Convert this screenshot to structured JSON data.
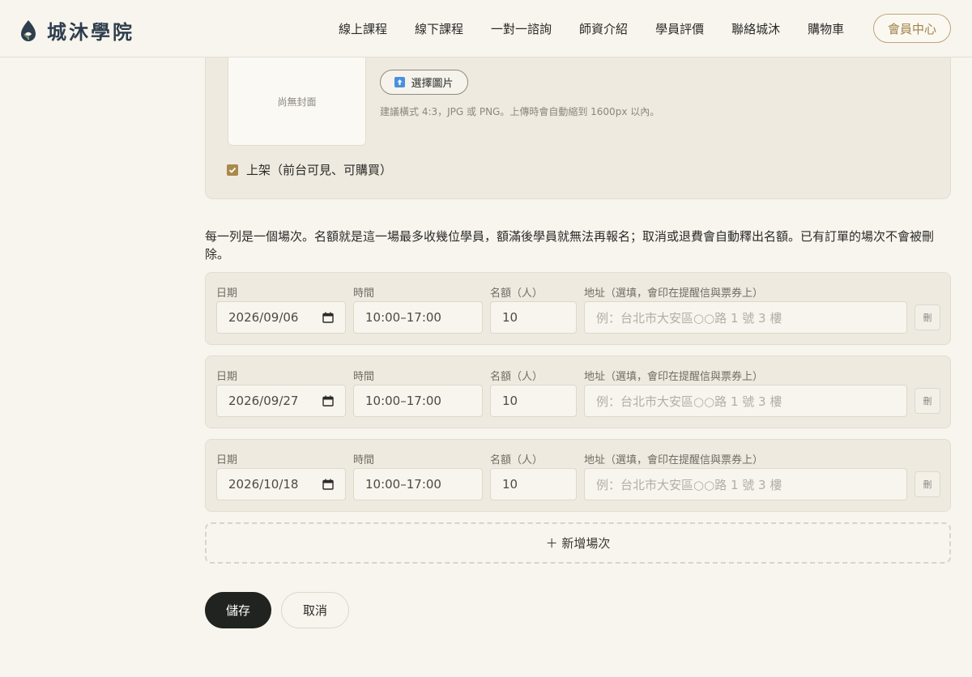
{
  "header": {
    "brand": "城沐學院",
    "nav": [
      "線上課程",
      "線下課程",
      "一對一諮詢",
      "師資介紹",
      "學員評價",
      "聯絡城沐",
      "購物車"
    ],
    "member_center": "會員中心"
  },
  "cover": {
    "empty_label": "尚無封面",
    "choose_label": "選擇圖片",
    "hint": "建議橫式 4:3，JPG 或 PNG。上傳時會自動縮到 1600px 以內。",
    "publish_label": "上架（前台可見、可購買）",
    "publish_checked": true
  },
  "description": "每一列是一個場次。名額就是這一場最多收幾位學員，額滿後學員就無法再報名；取消或退費會自動釋出名額。已有訂單的場次不會被刪除。",
  "labels": {
    "date": "日期",
    "time": "時間",
    "quota": "名額（人）",
    "address": "地址（選填，會印在提醒信與票券上）",
    "address_placeholder": "例：台北市大安區○○路 1 號 3 樓",
    "delete": "刪"
  },
  "sessions": [
    {
      "date": "2026/09/06",
      "time": "10:00–17:00",
      "quota": "10",
      "address": ""
    },
    {
      "date": "2026/09/27",
      "time": "10:00–17:00",
      "quota": "10",
      "address": ""
    },
    {
      "date": "2026/10/18",
      "time": "10:00–17:00",
      "quota": "10",
      "address": ""
    }
  ],
  "actions": {
    "add_session": "＋ 新增場次",
    "save": "儲存",
    "cancel": "取消"
  },
  "colors": {
    "background": "#f8f5ee",
    "card": "#eeeadf",
    "accent": "#a98a4b",
    "brand_text": "#2f3e4e",
    "save_button": "#20231f"
  }
}
